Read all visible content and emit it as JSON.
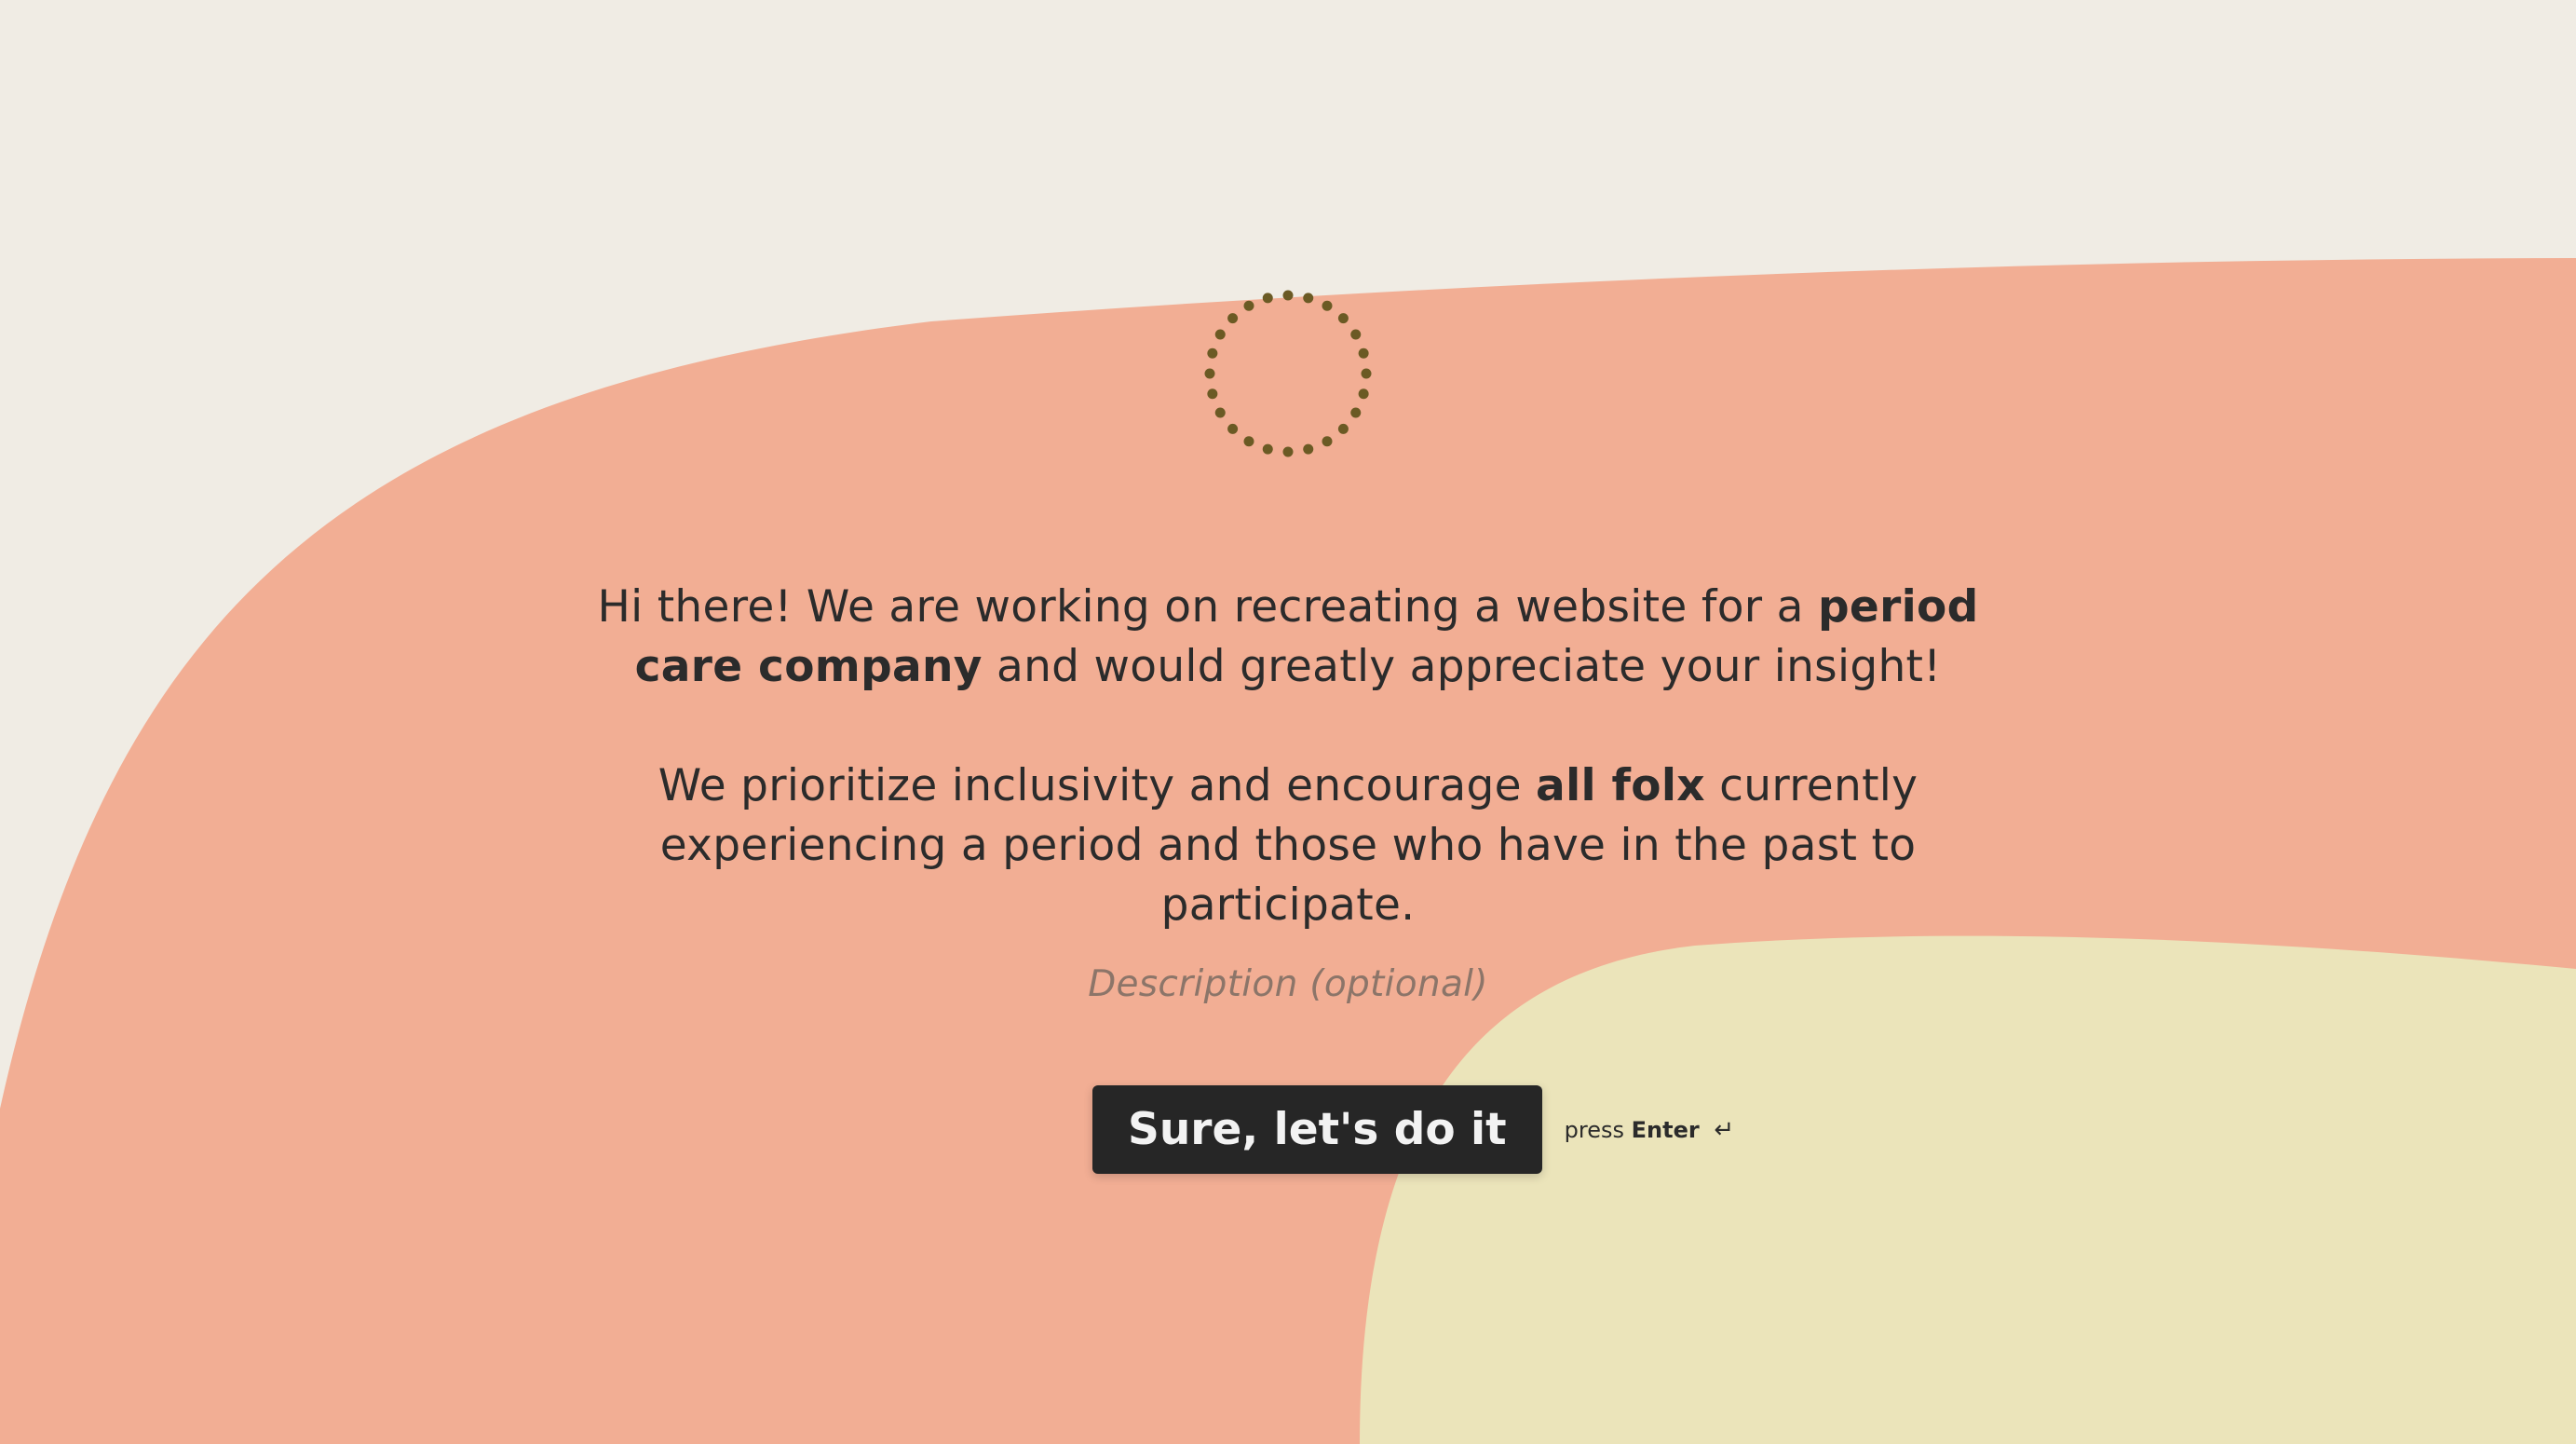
{
  "intro": {
    "p1_pre": "Hi there! We are working on recreating a website for a ",
    "p1_bold": "period care company",
    "p1_post": " and would greatly appreciate your insight!",
    "p2_pre": "We prioritize inclusivity and encourage ",
    "p2_bold": "all folx",
    "p2_post": " currently experiencing a period and those who have in the past to participate."
  },
  "description_placeholder": "Description (optional)",
  "cta": {
    "label": "Sure, let's do it"
  },
  "hint": {
    "press": "press",
    "key": "Enter",
    "icon": "↵"
  },
  "colors": {
    "background": "#f0ece4",
    "salmon_shape": "#f2ae94",
    "cream_shape": "#ebe4ba",
    "logo_dots": "#6b5a24",
    "button": "#262626",
    "text": "#2b2b2b"
  },
  "icons": {
    "logo": "dotted-circle-logo",
    "enter": "return-arrow-icon"
  }
}
